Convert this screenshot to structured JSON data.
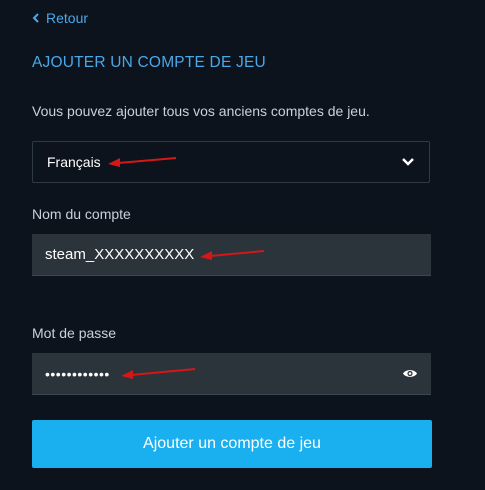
{
  "back": {
    "label": "Retour",
    "icon": "chevron-left-icon"
  },
  "heading": "AJOUTER UN COMPTE DE JEU",
  "description": "Vous pouvez ajouter tous vos anciens comptes de jeu.",
  "language_select": {
    "value": "Français",
    "icon": "chevron-down-icon"
  },
  "account_field": {
    "label": "Nom du compte",
    "value": "steam_XXXXXXXXXX"
  },
  "password_field": {
    "label": "Mot de passe",
    "value": "••••••••••••",
    "icon": "eye-icon"
  },
  "submit": {
    "label": "Ajouter un compte de jeu"
  },
  "colors": {
    "background": "#0c131c",
    "accent": "#4aa8e8",
    "button": "#1ab0f0",
    "input_bg": "#2b333b",
    "annotation_arrow": "#d41818"
  }
}
